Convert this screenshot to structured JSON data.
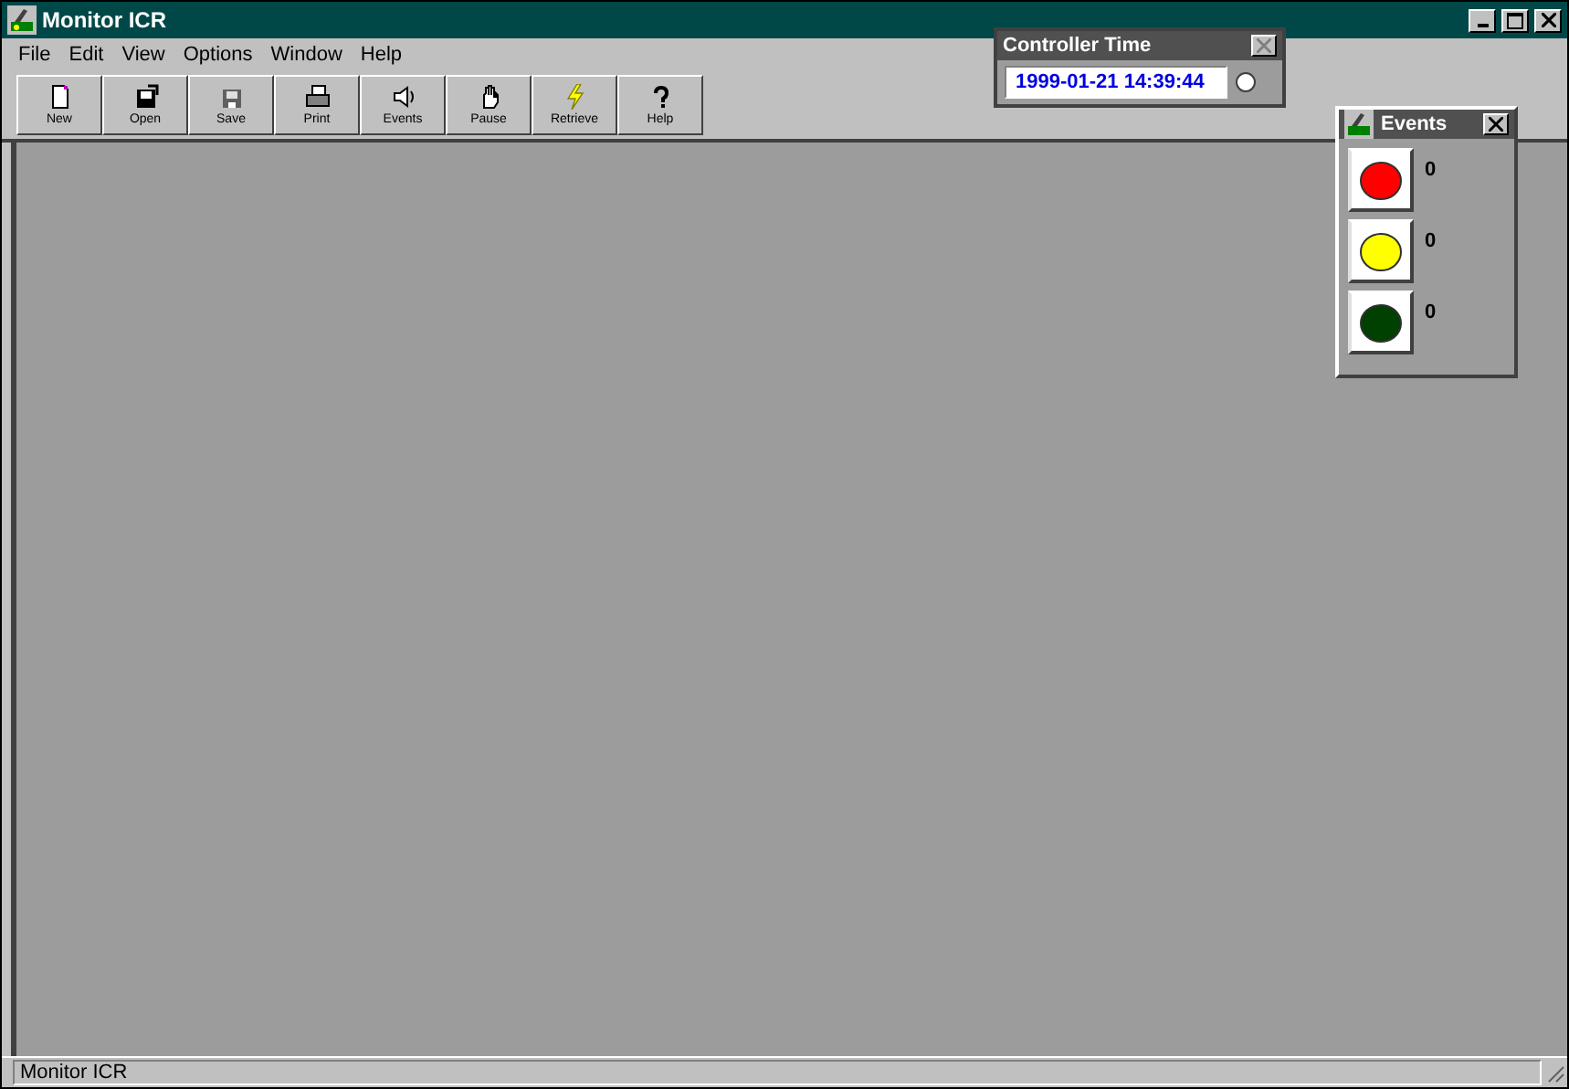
{
  "window": {
    "title": "Monitor ICR"
  },
  "menu": [
    "File",
    "Edit",
    "View",
    "Options",
    "Window",
    "Help"
  ],
  "toolbar": [
    {
      "kind": "new",
      "label": "New"
    },
    {
      "kind": "open",
      "label": "Open"
    },
    {
      "kind": "save",
      "label": "Save"
    },
    {
      "kind": "print",
      "label": "Print"
    },
    {
      "kind": "events",
      "label": "Events"
    },
    {
      "kind": "pause",
      "label": "Pause"
    },
    {
      "kind": "retrieve",
      "label": "Retrieve"
    },
    {
      "kind": "help",
      "label": "Help"
    }
  ],
  "controller_time": {
    "title": "Controller Time",
    "value": "1999-01-21 14:39:44"
  },
  "events_window": {
    "title": "Events",
    "lights": [
      {
        "color": "#ff0000",
        "count": "0"
      },
      {
        "color": "#ffff00",
        "count": "0"
      },
      {
        "color": "#004000",
        "count": "0"
      }
    ]
  },
  "status_bar": {
    "text": "Monitor ICR"
  }
}
